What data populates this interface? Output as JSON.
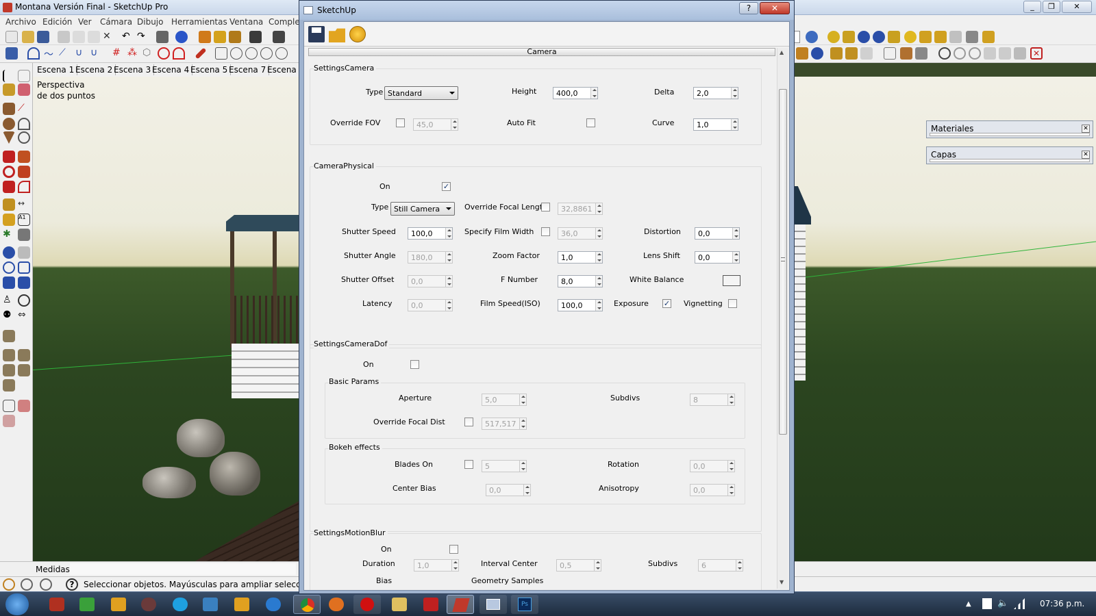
{
  "app": {
    "title": "Montana Versión Final - SketchUp Pro",
    "menu": [
      "Archivo",
      "Edición",
      "Ver",
      "Cámara",
      "Dibujo",
      "Herramientas",
      "Ventana",
      "Comple"
    ],
    "scenes": [
      "Escena 1",
      "Escena 2",
      "Escena 3",
      "Escena 4",
      "Escena 5",
      "Escena 7",
      "Escena"
    ],
    "viewport_label_1": "Perspectiva",
    "viewport_label_2": "de dos puntos",
    "measure_label": "Medidas",
    "status_text": "Seleccionar objetos. Mayúsculas para ampliar selecci",
    "clock": "07:36 p.m.",
    "panels": [
      {
        "label": "Materiales"
      },
      {
        "label": "Capas"
      }
    ]
  },
  "dialog": {
    "title": "SketchUp",
    "help_label": "?",
    "close_label": "✕",
    "tab_label": "Camera",
    "settings_camera": {
      "title": "SettingsCamera",
      "type_label": "Type",
      "type_value": "Standard",
      "height_label": "Height",
      "height_value": "400,0",
      "delta_label": "Delta",
      "delta_value": "2,0",
      "override_fov_label": "Override FOV",
      "fov_value": "45,0",
      "auto_fit_label": "Auto Fit",
      "curve_label": "Curve",
      "curve_value": "1,0"
    },
    "camera_physical": {
      "title": "CameraPhysical",
      "on_label": "On",
      "type_label": "Type",
      "type_value": "Still Camera",
      "override_focal_label": "Override Focal Length",
      "focal_value": "32,8861",
      "shutter_speed_label": "Shutter Speed",
      "shutter_speed_value": "100,0",
      "film_width_label": "Specify Film Width",
      "film_width_value": "36,0",
      "distortion_label": "Distortion",
      "distortion_value": "0,0",
      "shutter_angle_label": "Shutter Angle",
      "shutter_angle_value": "180,0",
      "zoom_label": "Zoom Factor",
      "zoom_value": "1,0",
      "lens_shift_label": "Lens Shift",
      "lens_shift_value": "0,0",
      "shutter_offset_label": "Shutter Offset",
      "shutter_offset_value": "0,0",
      "fnumber_label": "F Number",
      "fnumber_value": "8,0",
      "white_balance_label": "White Balance",
      "latency_label": "Latency",
      "latency_value": "0,0",
      "film_speed_label": "Film Speed(ISO)",
      "film_speed_value": "100,0",
      "exposure_label": "Exposure",
      "vignetting_label": "Vignetting"
    },
    "camera_dof": {
      "title": "SettingsCameraDof",
      "on_label": "On",
      "basic_title": "Basic Params",
      "aperture_label": "Aperture",
      "aperture_value": "5,0",
      "subdivs_label": "Subdivs",
      "subdivs_value": "8",
      "override_focal_dist_label": "Override Focal Dist",
      "focal_dist_value": "517,517",
      "bokeh_title": "Bokeh effects",
      "blades_label": "Blades On",
      "blades_value": "5",
      "rotation_label": "Rotation",
      "rotation_value": "0,0",
      "center_bias_label": "Center Bias",
      "center_bias_value": "0,0",
      "anisotropy_label": "Anisotropy",
      "anisotropy_value": "0,0"
    },
    "motion_blur": {
      "title": "SettingsMotionBlur",
      "on_label": "On",
      "duration_label": "Duration",
      "duration_value": "1,0",
      "interval_label": "Interval Center",
      "interval_value": "0,5",
      "subdivs_label": "Subdivs",
      "subdivs_value": "6",
      "bias_label": "Bias",
      "geometry_label": "Geometry Samples"
    }
  }
}
